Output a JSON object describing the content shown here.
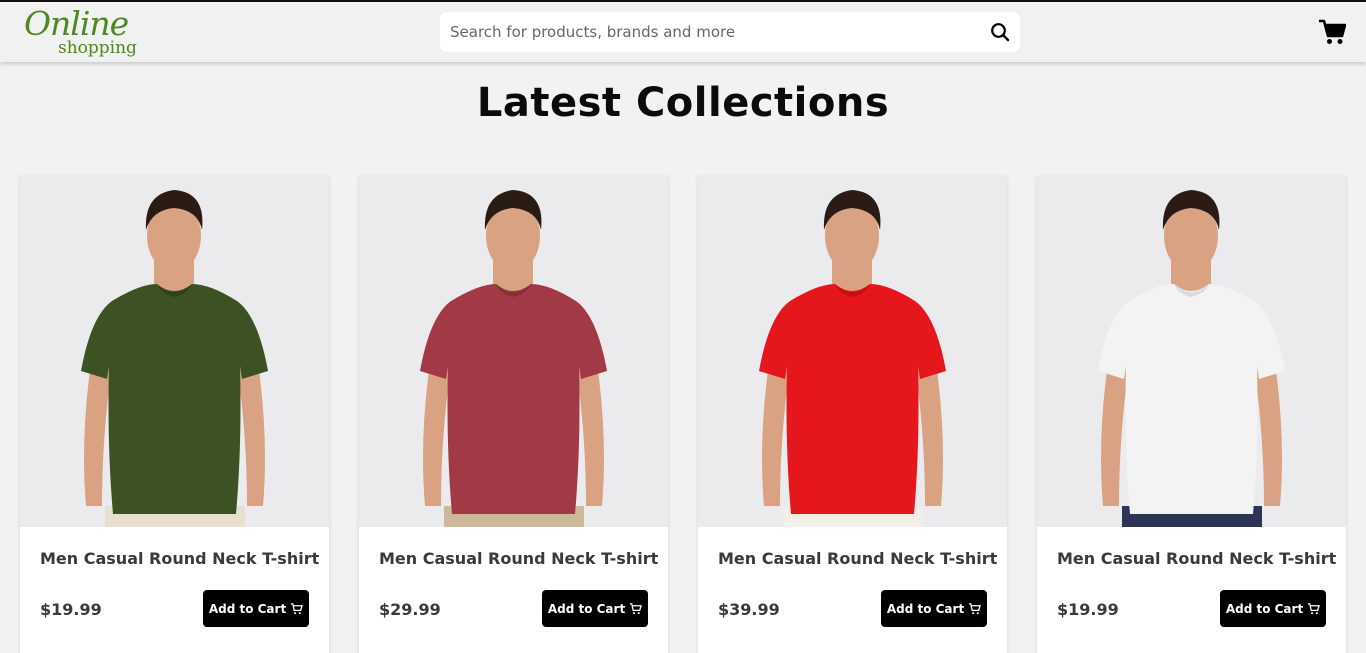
{
  "header": {
    "logo_line1": "Online",
    "logo_line2": "shopping",
    "search_placeholder": "Search for products, brands and more",
    "search_icon": "search-icon",
    "cart_icon": "cart-icon"
  },
  "page_title": "Latest Collections",
  "products": [
    {
      "title": "Men Casual Round Neck T-shirt",
      "price": "$19.99",
      "button_label": "Add to Cart",
      "shirt_color": "#3d5224",
      "shirt_shade": "#2f4219",
      "pants_color": "#e8dfd1"
    },
    {
      "title": "Men Casual Round Neck T-shirt",
      "price": "$29.99",
      "button_label": "Add to Cart",
      "shirt_color": "#a13a46",
      "shirt_shade": "#86303a",
      "pants_color": "#cdb89a"
    },
    {
      "title": "Men Casual Round Neck T-shirt",
      "price": "$39.99",
      "button_label": "Add to Cart",
      "shirt_color": "#e5161c",
      "shirt_shade": "#c40f15",
      "pants_color": "#f2efe9"
    },
    {
      "title": "Men Casual Round Neck T-shirt",
      "price": "$19.99",
      "button_label": "Add to Cart",
      "shirt_color": "#f3f3f3",
      "shirt_shade": "#dcdcdc",
      "pants_color": "#2c3457"
    }
  ],
  "colors": {
    "accent": "#4a8a1f",
    "button_bg": "#000000",
    "page_bg": "#f2f2f2"
  }
}
